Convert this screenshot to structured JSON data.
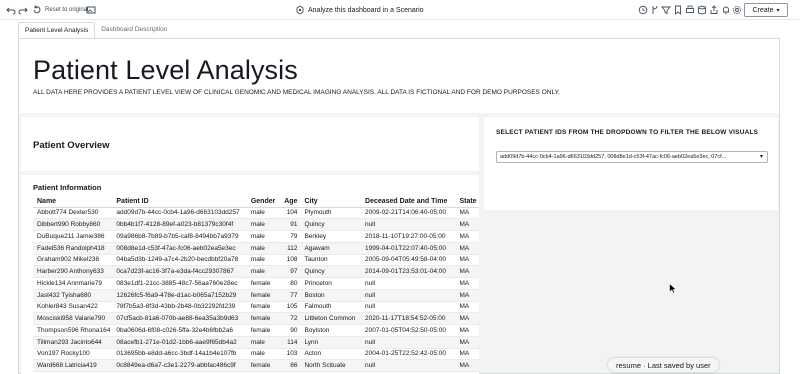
{
  "toolbar": {
    "reset_label": "Reset to original",
    "scenario_label": "Analyze this dashboard in a Scenario",
    "create_label": "Create"
  },
  "tabs": [
    {
      "label": "Patient Level Analysis",
      "active": true
    },
    {
      "label": "Dashboard Description",
      "active": false
    }
  ],
  "header": {
    "title": "Patient Level Analysis",
    "description": "ALL DATA HERE PROVIDES A PATIENT LEVEL VIEW OF CLINICAL GENOMIC AND MEDICAL IMAGING ANALYSIS. ALL DATA IS FICTIONAL AND FOR DEMO PURPOSES ONLY."
  },
  "overview": {
    "title": "Patient Overview"
  },
  "filter": {
    "title": "SELECT PATIENT IDS FROM THE DROPDOWN TO FILTER THE BELOW VISUALS",
    "selected_value": "add09d7b-44cc-0cb4-1a96-d663103dd257, 008d8e1d-c53f-47ac-fc06-aeb02ea5e3ec, 07cf..."
  },
  "table": {
    "title": "Patient Information",
    "columns": [
      "Name",
      "Patient ID",
      "Gender",
      "Age",
      "City",
      "Deceased Date and Time",
      "State"
    ],
    "rows": [
      [
        "Abbott774 Dexter530",
        "add09d7b-44cc-0cb4-1a96-d663103dd257",
        "male",
        "104",
        "Plymouth",
        "2009-02-21T14:06:40-05:00",
        "MA"
      ],
      [
        "Dibbert990 Robby860",
        "0bb4b1f7-4128-89ef-a023-b81379c30f4f",
        "male",
        "91",
        "Quincy",
        "null",
        "MA"
      ],
      [
        "DuBuque211 Jamie386",
        "09a986b8-7b89-b7b5-caf8-8494bb7a9379",
        "male",
        "79",
        "Berkley",
        "2018-11-10T19:27:00-05:00",
        "MA"
      ],
      [
        "Fadel536 Randolph418",
        "008d8e1d-c53f-47ac-fc06-aeb02ea5e3ec",
        "male",
        "112",
        "Agawam",
        "1999-04-01T22:07:40-05:00",
        "MA"
      ],
      [
        "Graham902 Mikel238",
        "04ba5d3b-1249-a7c4-2b20-becdbbf20a78",
        "male",
        "108",
        "Taunton",
        "2005-09-04T05:49:58-04:00",
        "MA"
      ],
      [
        "Harber290 Anthony633",
        "0ca7d23f-ac16-3f7a-e3da-f4cc29307867",
        "male",
        "97",
        "Quincy",
        "2014-09-01T23:53:01-04:00",
        "MA"
      ],
      [
        "Hickle134 Annmarie79",
        "083e1df1-21cc-3885-48c7-56aa760e28ec",
        "female",
        "80",
        "Princeton",
        "null",
        "MA"
      ],
      [
        "Jast432 Tyisha680",
        "12626fc5-f6a9-478e-d1ac-b065a7152b29",
        "female",
        "77",
        "Boston",
        "null",
        "MA"
      ],
      [
        "Kohler843 Susan422",
        "78f7b5a3-8f3d-43bb-2b48-0b32292fd239",
        "female",
        "105",
        "Falmouth",
        "null",
        "MA"
      ],
      [
        "Mosciski958 Valarie790",
        "07cf5acb-81a6-070b-ae88-6ea35a3b9d63",
        "female",
        "72",
        "Littleton Common",
        "2020-11-17T18:54:52-05:00",
        "MA"
      ],
      [
        "Thompson596 Rhona164",
        "0ba0606d-6f08-c026-5ffa-32e4b6fbb2a6",
        "female",
        "90",
        "Boylston",
        "2007-01-05T04:52:50-05:00",
        "MA"
      ],
      [
        "Tillman293 Jacinto644",
        "08acefb1-271e-01d2-1bb6-aae9f65db4a2",
        "male",
        "114",
        "Lynn",
        "null",
        "MA"
      ],
      [
        "Von197 Rocky100",
        "013695bb-e8dd-a6cc-3bdf-14a1b4e107fb",
        "male",
        "103",
        "Acton",
        "2004-01-25T22:52:42-05:00",
        "MA"
      ],
      [
        "Ward668 Latricia419",
        "0c8849ea-d6a7-c3e1-2279-abbfac486c9f",
        "female",
        "86",
        "North Scituate",
        "null",
        "MA"
      ]
    ]
  },
  "status": {
    "text": "resume · Last saved by user"
  },
  "colors": {
    "accent": "#16191f",
    "panel_bg": "#ffffff",
    "canvas_bg": "#f2f3f3"
  }
}
